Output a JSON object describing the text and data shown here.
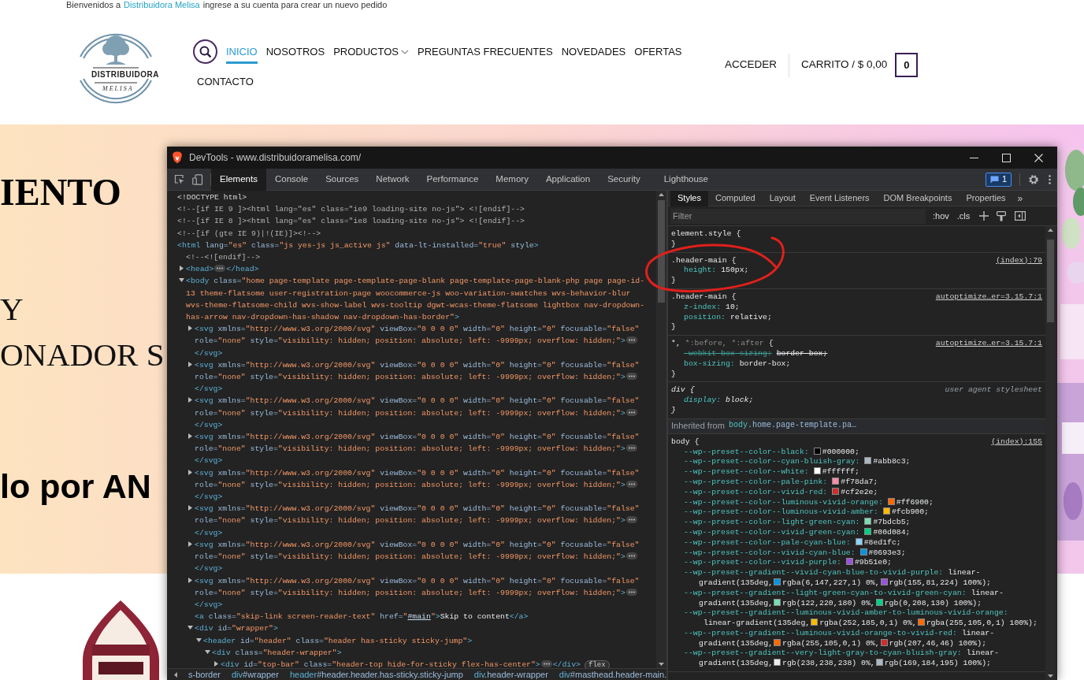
{
  "top_bar": {
    "before": "Bienvenidos a",
    "link": "Distribuidora Melisa",
    "after": "ingrese a su cuenta para crear un nuevo pedido"
  },
  "header": {
    "logo": {
      "name": "DISTRIBUIDORA",
      "subtitle": "MELISA"
    },
    "nav": [
      {
        "label": "INICIO",
        "selected": true,
        "dropdown": false
      },
      {
        "label": "NOSOTROS",
        "selected": false,
        "dropdown": false
      },
      {
        "label": "PRODUCTOS",
        "selected": false,
        "dropdown": true
      },
      {
        "label": "PREGUNTAS FRECUENTES",
        "selected": false,
        "dropdown": false
      },
      {
        "label": "NOVEDADES",
        "selected": false,
        "dropdown": false
      },
      {
        "label": "OFERTAS",
        "selected": false,
        "dropdown": false
      },
      {
        "label": "CONTACTO",
        "selected": false,
        "dropdown": false
      }
    ],
    "account": "ACCEDER",
    "cart": {
      "label": "CARRITO / $ 0,00",
      "count": "0"
    }
  },
  "hero": {
    "lines": [
      {
        "text": "IENTO",
        "kind": "heading"
      },
      {
        "text": "Y",
        "kind": "serif"
      },
      {
        "text": "ONADOR S",
        "kind": "serif"
      },
      {
        "text": "lo por AN",
        "kind": "bold"
      }
    ]
  },
  "devtools": {
    "title": "DevTools - www.distribuidoramelisa.com/",
    "tabs": [
      {
        "label": "Elements",
        "selected": true
      },
      {
        "label": "Console",
        "selected": false
      },
      {
        "label": "Sources",
        "selected": false
      },
      {
        "label": "Network",
        "selected": false
      },
      {
        "label": "Performance",
        "selected": false
      },
      {
        "label": "Memory",
        "selected": false
      },
      {
        "label": "Application",
        "selected": false
      },
      {
        "label": "Security",
        "selected": false
      },
      {
        "label": "Lighthouse",
        "selected": false
      }
    ],
    "issues_count": "1",
    "dom_tree": [
      {
        "kind": "doctype",
        "text": "<!DOCTYPE html>"
      },
      {
        "kind": "comment",
        "text": "<!--[if IE 9 ]><html lang=\"es\" class=\"ie9 loading-site no-js\"> <![endif]-->"
      },
      {
        "kind": "comment",
        "text": "<!--[if IE 8 ]><html lang=\"es\" class=\"ie8 loading-site no-js\"> <![endif]-->"
      },
      {
        "kind": "comment",
        "text": "<!--[if (gte IE 9)|!(IE)]><!-->"
      },
      {
        "kind": "element",
        "open": [
          {
            "code": "<html lang=\"es\" class=\"js yes-js js_active js\" data-lt-installed=\"true\" style>"
          }
        ],
        "children": [
          {
            "kind": "comment",
            "text": "<!--<![endif]-->"
          },
          {
            "kind": "element",
            "open": [
              {
                "code": "<head>"
              }
            ],
            "expanded": false,
            "close": "</head>"
          },
          {
            "kind": "element",
            "open": [
              {
                "code": "<body class=\"home page-template page-template-page-blank page-template-page-blank-php page page-id-13 theme-flatsome user-registration-page woocommerce-js woo-variation-swatches wvs-behavior-blur wvs-theme-flatsome-child wvs-show-label wvs-tooltip dgwt-wcas-theme-flatsome lightbox nav-dropdown-has-arrow nav-dropdown-has-shadow nav-dropdown-has-border\">"
              }
            ],
            "expanded": true,
            "children": [
              {
                "kind": "element",
                "open": [
                  {
                    "code": "<svg xmlns=\"http://www.w3.org/2000/svg\" viewBox=\"0 0 0 0\" width=\"0\" height=\"0\" focusable=\"false\" role=\"none\" style=\"visibility: hidden; position: absolute; left: -9999px; overflow: hidden;\">"
                  }
                ],
                "expanded": false,
                "close": "</svg>"
              },
              {
                "kind": "element",
                "open": [
                  {
                    "code": "<svg xmlns=\"http://www.w3.org/2000/svg\" viewBox=\"0 0 0 0\" width=\"0\" height=\"0\" focusable=\"false\" role=\"none\" style=\"visibility: hidden; position: absolute; left: -9999px; overflow: hidden;\">"
                  }
                ],
                "expanded": false,
                "close": "</svg>"
              },
              {
                "kind": "element",
                "open": [
                  {
                    "code": "<svg xmlns=\"http://www.w3.org/2000/svg\" viewBox=\"0 0 0 0\" width=\"0\" height=\"0\" focusable=\"false\" role=\"none\" style=\"visibility: hidden; position: absolute; left: -9999px; overflow: hidden;\">"
                  }
                ],
                "expanded": false,
                "close": "</svg>"
              },
              {
                "kind": "element",
                "open": [
                  {
                    "code": "<svg xmlns=\"http://www.w3.org/2000/svg\" viewBox=\"0 0 0 0\" width=\"0\" height=\"0\" focusable=\"false\" role=\"none\" style=\"visibility: hidden; position: absolute; left: -9999px; overflow: hidden;\">"
                  }
                ],
                "expanded": false,
                "close": "</svg>"
              },
              {
                "kind": "element",
                "open": [
                  {
                    "code": "<svg xmlns=\"http://www.w3.org/2000/svg\" viewBox=\"0 0 0 0\" width=\"0\" height=\"0\" focusable=\"false\" role=\"none\" style=\"visibility: hidden; position: absolute; left: -9999px; overflow: hidden;\">"
                  }
                ],
                "expanded": false,
                "close": "</svg>"
              },
              {
                "kind": "element",
                "open": [
                  {
                    "code": "<svg xmlns=\"http://www.w3.org/2000/svg\" viewBox=\"0 0 0 0\" width=\"0\" height=\"0\" focusable=\"false\" role=\"none\" style=\"visibility: hidden; position: absolute; left: -9999px; overflow: hidden;\">"
                  }
                ],
                "expanded": false,
                "close": "</svg>"
              },
              {
                "kind": "element",
                "open": [
                  {
                    "code": "<svg xmlns=\"http://www.w3.org/2000/svg\" viewBox=\"0 0 0 0\" width=\"0\" height=\"0\" focusable=\"false\" role=\"none\" style=\"visibility: hidden; position: absolute; left: -9999px; overflow: hidden;\">"
                  }
                ],
                "expanded": false,
                "close": "</svg>"
              },
              {
                "kind": "element",
                "open": [
                  {
                    "code": "<svg xmlns=\"http://www.w3.org/2000/svg\" viewBox=\"0 0 0 0\" width=\"0\" height=\"0\" focusable=\"false\" role=\"none\" style=\"visibility: hidden; position: absolute; left: -9999px; overflow: hidden;\">"
                  }
                ],
                "expanded": false,
                "close": "</svg>"
              },
              {
                "kind": "element",
                "open": [
                  {
                    "code": "<a class=\"skip-link screen-reader-text\" href=\""
                  },
                  {
                    "link": "#main"
                  },
                  {
                    "code": "\">"
                  },
                  {
                    "text": "Skip to content"
                  },
                  {
                    "code": "</a>"
                  }
                ]
              },
              {
                "kind": "element",
                "open": [
                  {
                    "code": "<div id=\"wrapper\">"
                  }
                ],
                "expanded": true,
                "children": [
                  {
                    "kind": "element",
                    "open": [
                      {
                        "code": "<header id=\"header\" class=\"header has-sticky sticky-jump\">"
                      }
                    ],
                    "expanded": true,
                    "children": [
                      {
                        "kind": "element",
                        "open": [
                          {
                            "code": "<div class=\"header-wrapper\">"
                          }
                        ],
                        "expanded": true,
                        "children": [
                          {
                            "kind": "element",
                            "open": [
                              {
                                "code": "<div id=\"top-bar\" class=\"header-top hide-for-sticky flex-has-center\">"
                              }
                            ],
                            "expanded": false,
                            "close": "</div>",
                            "badge": "flex"
                          }
                        ]
                      }
                    ]
                  }
                ]
              }
            ]
          }
        ]
      }
    ],
    "breadcrumbs": [
      {
        "rest": "s-border"
      },
      {
        "tag": "div",
        "rest": "#wrapper"
      },
      {
        "tag": "header",
        "rest": "#header.header.has-sticky.sticky-jump"
      },
      {
        "tag": "div",
        "rest": ".header-wrapper"
      },
      {
        "tag": "div",
        "rest": "#masthead.header-main."
      }
    ],
    "styles": {
      "tabs": [
        {
          "label": "Styles",
          "selected": true
        },
        {
          "label": "Computed",
          "selected": false
        },
        {
          "label": "Layout",
          "selected": false
        },
        {
          "label": "Event Listeners",
          "selected": false
        },
        {
          "label": "DOM Breakpoints",
          "selected": false
        },
        {
          "label": "Properties",
          "selected": false
        }
      ],
      "more": "»",
      "filter": {
        "placeholder": "Filter"
      },
      "toggles": [
        ":hov",
        ".cls"
      ],
      "rules": [
        {
          "kind": "normal",
          "selector": "element.style",
          "brace": "{",
          "close": "}"
        },
        {
          "kind": "normal",
          "selector": ".header-main",
          "brace": "{",
          "source": "(index):79",
          "close": "}",
          "props": [
            {
              "name": "height:",
              "value": [
                {
                  "text": "150px;"
                }
              ],
              "overridden": false
            }
          ]
        },
        {
          "kind": "normal",
          "selector": ".header-main",
          "brace": "{",
          "source": "autoptimize…er=3.15.7:1",
          "close": "}",
          "props": [
            {
              "name": "z-index:",
              "value": [
                {
                  "text": "10;"
                }
              ],
              "overridden": false
            },
            {
              "name": "position:",
              "value": [
                {
                  "text": "relative;"
                }
              ],
              "overridden": false
            }
          ]
        },
        {
          "kind": "normal",
          "selector": "*,",
          "unmatched": "*:before, *:after",
          "brace": "{",
          "source": "autoptimize…er=3.15.7:1",
          "close": "}",
          "props": [
            {
              "name": "-webkit-box-sizing:",
              "value": [
                {
                  "text": "border-box;"
                }
              ],
              "overridden": true
            },
            {
              "name": "box-sizing:",
              "value": [
                {
                  "text": "border-box;"
                }
              ],
              "overridden": false
            }
          ]
        },
        {
          "kind": "user_agent",
          "selector": "div",
          "brace": "{",
          "source": "user agent stylesheet",
          "close": "}",
          "props": [
            {
              "name": "display:",
              "value": [
                {
                  "text": "block;"
                }
              ],
              "overridden": false
            }
          ]
        }
      ],
      "inherited": {
        "label": "Inherited from",
        "element": {
          "tag": "body",
          "rest": ".home.page-template.pa…"
        },
        "rules": [
          {
            "kind": "normal",
            "selector": "body",
            "brace": "{",
            "source": "(index):155",
            "props": [
              {
                "name": "--wp--preset--color--black:",
                "value": [
                  {
                    "color": "#000000",
                    "text": "#000000;"
                  }
                ],
                "overridden": false
              },
              {
                "name": "--wp--preset--color--cyan-bluish-gray:",
                "value": [
                  {
                    "color": "#abb8c3",
                    "text": "#abb8c3;"
                  }
                ],
                "overridden": false
              },
              {
                "name": "--wp--preset--color--white:",
                "value": [
                  {
                    "color": "#ffffff",
                    "text": "#ffffff;"
                  }
                ],
                "overridden": false
              },
              {
                "name": "--wp--preset--color--pale-pink:",
                "value": [
                  {
                    "color": "#f78da7",
                    "text": "#f78da7;"
                  }
                ],
                "overridden": false
              },
              {
                "name": "--wp--preset--color--vivid-red:",
                "value": [
                  {
                    "color": "#cf2e2e",
                    "text": "#cf2e2e;"
                  }
                ],
                "overridden": false
              },
              {
                "name": "--wp--preset--color--luminous-vivid-orange:",
                "value": [
                  {
                    "color": "#ff6900",
                    "text": "#ff6900;"
                  }
                ],
                "overridden": false
              },
              {
                "name": "--wp--preset--color--luminous-vivid-amber:",
                "value": [
                  {
                    "color": "#fcb900",
                    "text": "#fcb900;"
                  }
                ],
                "overridden": false
              },
              {
                "name": "--wp--preset--color--light-green-cyan:",
                "value": [
                  {
                    "color": "#7bdcb5",
                    "text": "#7bdcb5;"
                  }
                ],
                "overridden": false
              },
              {
                "name": "--wp--preset--color--vivid-green-cyan:",
                "value": [
                  {
                    "color": "#00d084",
                    "text": "#00d084;"
                  }
                ],
                "overridden": false
              },
              {
                "name": "--wp--preset--color--pale-cyan-blue:",
                "value": [
                  {
                    "color": "#8ed1fc",
                    "text": "#8ed1fc;"
                  }
                ],
                "overridden": false
              },
              {
                "name": "--wp--preset--color--vivid-cyan-blue:",
                "value": [
                  {
                    "color": "#0693e3",
                    "text": "#0693e3;"
                  }
                ],
                "overridden": false
              },
              {
                "name": "--wp--preset--color--vivid-purple:",
                "value": [
                  {
                    "color": "#9b51e0",
                    "text": "#9b51e0;"
                  }
                ],
                "overridden": false
              },
              {
                "name": "--wp--preset--gradient--vivid-cyan-blue-to-vivid-purple:",
                "value": [
                  {
                    "text": "linear-"
                  },
                  {
                    "text": "gradient(135deg,"
                  },
                  {
                    "color": "#0693e3",
                    "text": "rgba(6,147,227,1) 0%,"
                  },
                  {
                    "color": "#9b51e0",
                    "text": "rgb(155,81,224) 100%);"
                  }
                ],
                "overridden": false
              },
              {
                "name": "--wp--preset--gradient--light-green-cyan-to-vivid-green-cyan:",
                "value": [
                  {
                    "text": "linear-"
                  },
                  {
                    "text": "gradient(135deg,"
                  },
                  {
                    "color": "#7adcb4",
                    "text": "rgb(122,220,180) 0%,"
                  },
                  {
                    "color": "#00d082",
                    "text": "rgb(0,208,130) 100%);"
                  }
                ],
                "overridden": false
              },
              {
                "name": "--wp--preset--gradient--luminous-vivid-amber-to-luminous-vivid-orange:",
                "value": [
                  {
                    "text": "linear-gradient(135deg,"
                  },
                  {
                    "color": "#fcb900",
                    "text": "rgba(252,185,0,1) 0%,"
                  },
                  {
                    "color": "#ff6900",
                    "text": "rgba(255,105,0,1) 100%);"
                  }
                ],
                "overridden": false
              },
              {
                "name": "--wp--preset--gradient--luminous-vivid-orange-to-vivid-red:",
                "value": [
                  {
                    "text": "linear-"
                  },
                  {
                    "text": "gradient(135deg,"
                  },
                  {
                    "color": "#ff6900",
                    "text": "rgba(255,105,0,1) 0%,"
                  },
                  {
                    "color": "#cf2e2e",
                    "text": "rgb(207,46,46) 100%);"
                  }
                ],
                "overridden": false
              },
              {
                "name": "--wp--preset--gradient--very-light-gray-to-cyan-bluish-gray:",
                "value": [
                  {
                    "text": "linear-"
                  },
                  {
                    "text": "gradient(135deg,"
                  },
                  {
                    "color": "#eeeeee",
                    "text": "rgb(238,238,238) 0%,"
                  },
                  {
                    "color": "#a9b8c3",
                    "text": "rgb(169,184,195) 100%);"
                  }
                ],
                "overridden": false
              }
            ]
          }
        ]
      }
    }
  }
}
